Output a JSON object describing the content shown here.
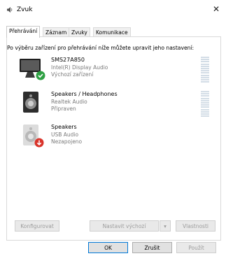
{
  "window": {
    "title": "Zvuk",
    "close_glyph": "✕"
  },
  "tabs": [
    {
      "label": "Přehrávání",
      "active": true
    },
    {
      "label": "Záznam",
      "active": false
    },
    {
      "label": "Zvuky",
      "active": false
    },
    {
      "label": "Komunikace",
      "active": false
    }
  ],
  "instruction": "Po výběru zařízení pro přehrávání níže můžete upravit jeho nastavení:",
  "devices": [
    {
      "name": "SMS27A850",
      "driver": "Intel(R) Display Audio",
      "status": "Výchozí zařízení",
      "icon": "monitor-icon",
      "badge": "default-check-icon"
    },
    {
      "name": "Speakers / Headphones",
      "driver": "Realtek Audio",
      "status": "Připraven",
      "icon": "speaker-icon",
      "badge": ""
    },
    {
      "name": "Speakers",
      "driver": "USB Audio",
      "status": "Nezapojeno",
      "icon": "speaker-icon",
      "badge": "unplugged-arrow-icon"
    }
  ],
  "buttons": {
    "configure": "Konfigurovat",
    "set_default": "Nastavit výchozí",
    "dropdown_glyph": "▾",
    "properties": "Vlastnosti",
    "ok": "OK",
    "cancel": "Zrušit",
    "apply": "Použít"
  },
  "colors": {
    "accent": "#0078d7",
    "check": "#2ea043",
    "unplugged": "#d9342b"
  }
}
